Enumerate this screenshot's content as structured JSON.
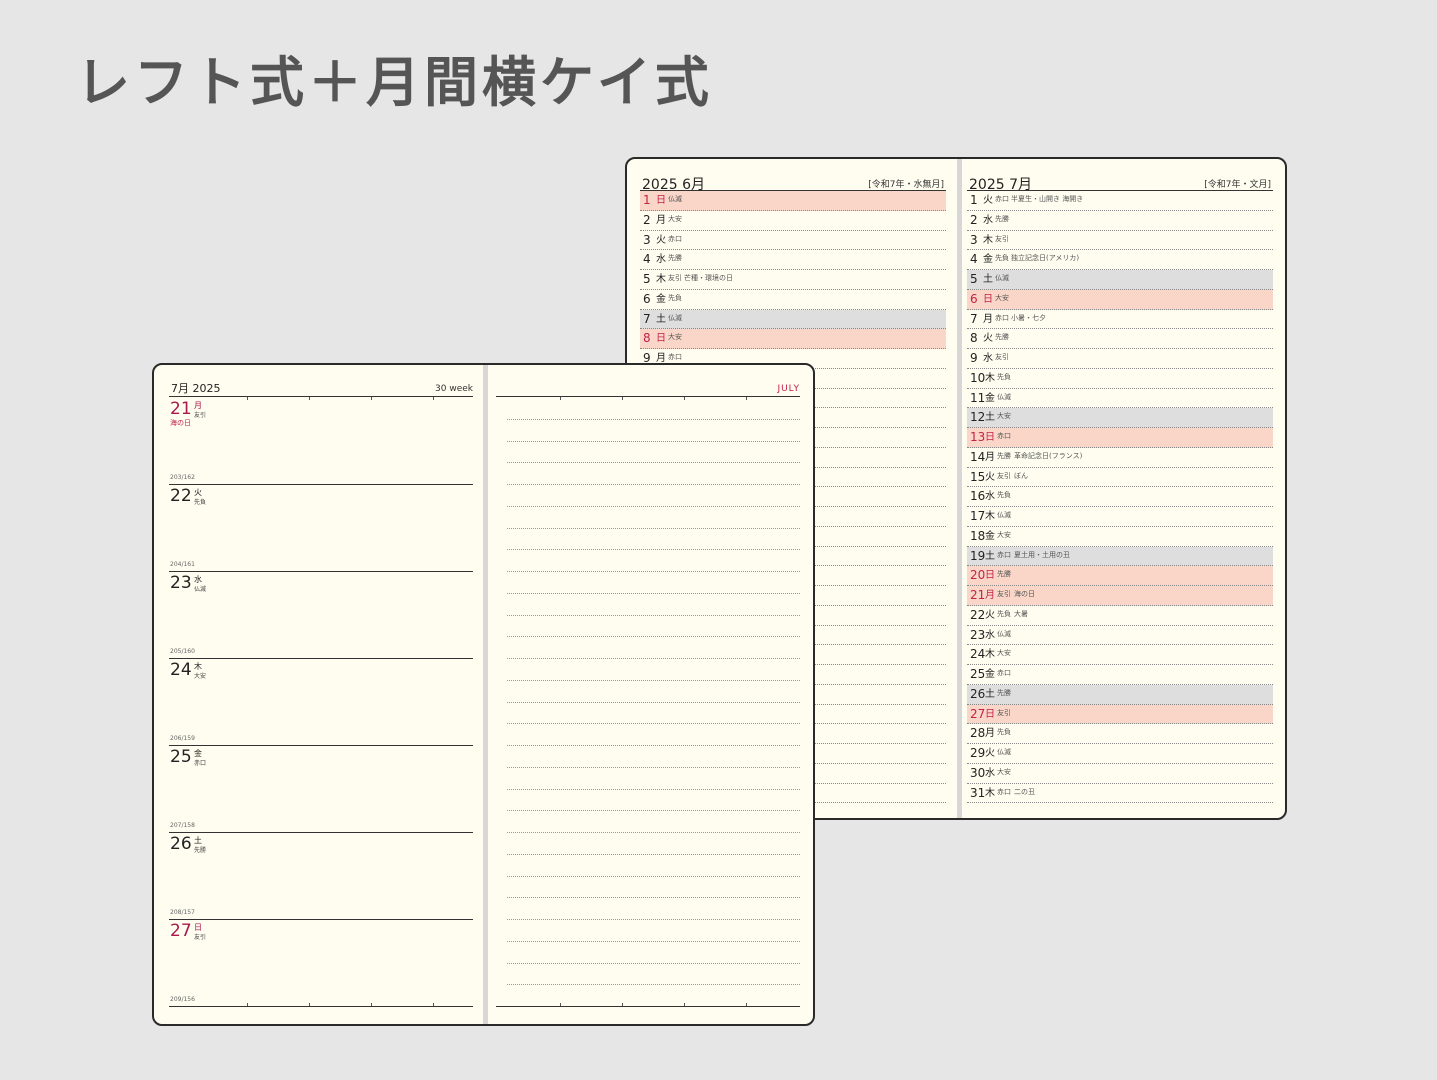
{
  "headline": "レフト式＋月間横ケイ式",
  "monthly": {
    "left": {
      "year_month": "2025 6月",
      "era": "[令和7年・水無月]",
      "days": [
        {
          "d": "1",
          "w": "日",
          "r": "仏滅",
          "ev": "",
          "type": "hol"
        },
        {
          "d": "2",
          "w": "月",
          "r": "大安",
          "ev": "",
          "type": ""
        },
        {
          "d": "3",
          "w": "火",
          "r": "赤口",
          "ev": "",
          "type": ""
        },
        {
          "d": "4",
          "w": "水",
          "r": "先勝",
          "ev": "",
          "type": ""
        },
        {
          "d": "5",
          "w": "木",
          "r": "友引",
          "ev": "芒種・環境の日",
          "type": ""
        },
        {
          "d": "6",
          "w": "金",
          "r": "先負",
          "ev": "",
          "type": ""
        },
        {
          "d": "7",
          "w": "土",
          "r": "仏滅",
          "ev": "",
          "type": "sat"
        },
        {
          "d": "8",
          "w": "日",
          "r": "大安",
          "ev": "",
          "type": "hol"
        },
        {
          "d": "9",
          "w": "月",
          "r": "赤口",
          "ev": "",
          "type": ""
        }
      ]
    },
    "right": {
      "year_month": "2025 7月",
      "era": "[令和7年・文月]",
      "days": [
        {
          "d": "1",
          "w": "火",
          "r": "赤口",
          "ev": "半夏生・山開き 海開き",
          "type": ""
        },
        {
          "d": "2",
          "w": "水",
          "r": "先勝",
          "ev": "",
          "type": ""
        },
        {
          "d": "3",
          "w": "木",
          "r": "友引",
          "ev": "",
          "type": ""
        },
        {
          "d": "4",
          "w": "金",
          "r": "先負",
          "ev": "独立記念日(アメリカ)",
          "type": ""
        },
        {
          "d": "5",
          "w": "土",
          "r": "仏滅",
          "ev": "",
          "type": "sat"
        },
        {
          "d": "6",
          "w": "日",
          "r": "大安",
          "ev": "",
          "type": "hol"
        },
        {
          "d": "7",
          "w": "月",
          "r": "赤口",
          "ev": "小暑・七夕",
          "type": ""
        },
        {
          "d": "8",
          "w": "火",
          "r": "先勝",
          "ev": "",
          "type": ""
        },
        {
          "d": "9",
          "w": "水",
          "r": "友引",
          "ev": "",
          "type": ""
        },
        {
          "d": "10",
          "w": "木",
          "r": "先負",
          "ev": "",
          "type": ""
        },
        {
          "d": "11",
          "w": "金",
          "r": "仏滅",
          "ev": "",
          "type": ""
        },
        {
          "d": "12",
          "w": "土",
          "r": "大安",
          "ev": "",
          "type": "sat"
        },
        {
          "d": "13",
          "w": "日",
          "r": "赤口",
          "ev": "",
          "type": "hol"
        },
        {
          "d": "14",
          "w": "月",
          "r": "先勝",
          "ev": "革命記念日(フランス)",
          "type": ""
        },
        {
          "d": "15",
          "w": "火",
          "r": "友引",
          "ev": "ぼん",
          "type": ""
        },
        {
          "d": "16",
          "w": "水",
          "r": "先負",
          "ev": "",
          "type": ""
        },
        {
          "d": "17",
          "w": "木",
          "r": "仏滅",
          "ev": "",
          "type": ""
        },
        {
          "d": "18",
          "w": "金",
          "r": "大安",
          "ev": "",
          "type": ""
        },
        {
          "d": "19",
          "w": "土",
          "r": "赤口",
          "ev": "夏土用・土用の丑",
          "type": "sat"
        },
        {
          "d": "20",
          "w": "日",
          "r": "先勝",
          "ev": "",
          "type": "hol"
        },
        {
          "d": "21",
          "w": "月",
          "r": "友引",
          "ev": "海の日",
          "type": "hol"
        },
        {
          "d": "22",
          "w": "火",
          "r": "先負",
          "ev": "大暑",
          "type": ""
        },
        {
          "d": "23",
          "w": "水",
          "r": "仏滅",
          "ev": "",
          "type": ""
        },
        {
          "d": "24",
          "w": "木",
          "r": "大安",
          "ev": "",
          "type": ""
        },
        {
          "d": "25",
          "w": "金",
          "r": "赤口",
          "ev": "",
          "type": ""
        },
        {
          "d": "26",
          "w": "土",
          "r": "先勝",
          "ev": "",
          "type": "sat"
        },
        {
          "d": "27",
          "w": "日",
          "r": "友引",
          "ev": "",
          "type": "hol"
        },
        {
          "d": "28",
          "w": "月",
          "r": "先負",
          "ev": "",
          "type": ""
        },
        {
          "d": "29",
          "w": "火",
          "r": "仏滅",
          "ev": "",
          "type": ""
        },
        {
          "d": "30",
          "w": "水",
          "r": "大安",
          "ev": "",
          "type": ""
        },
        {
          "d": "31",
          "w": "木",
          "r": "赤口",
          "ev": "二の丑",
          "type": ""
        }
      ]
    }
  },
  "weekly": {
    "month_year": "7月  2025",
    "week_label": "30 week",
    "month_en": "JULY",
    "days": [
      {
        "doy": "",
        "num": "21",
        "wd": "月",
        "rk": "友引",
        "hn": "海の日",
        "red": true
      },
      {
        "doy": "203/162",
        "num": "22",
        "wd": "火",
        "rk": "先負",
        "hn": "",
        "red": false
      },
      {
        "doy": "204/161",
        "num": "23",
        "wd": "水",
        "rk": "仏滅",
        "hn": "",
        "red": false
      },
      {
        "doy": "205/160",
        "num": "24",
        "wd": "木",
        "rk": "大安",
        "hn": "",
        "red": false
      },
      {
        "doy": "206/159",
        "num": "25",
        "wd": "金",
        "rk": "赤口",
        "hn": "",
        "red": false
      },
      {
        "doy": "207/158",
        "num": "26",
        "wd": "土",
        "rk": "先勝",
        "hn": "",
        "red": false
      },
      {
        "doy": "208/157",
        "num": "27",
        "wd": "日",
        "rk": "友引",
        "hn": "",
        "red": true
      }
    ],
    "last_doy": "209/156"
  }
}
